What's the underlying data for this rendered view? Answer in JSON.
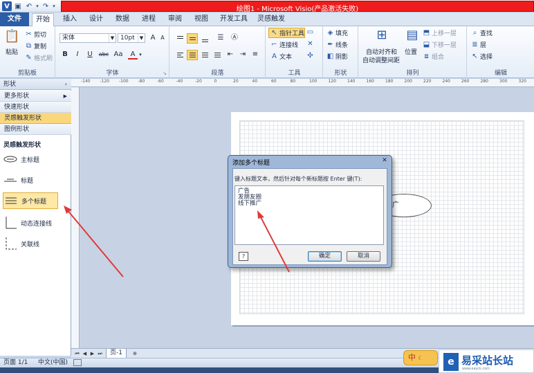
{
  "app": {
    "window_title": "绘图1 - Microsoft Visio(产品激活失败)"
  },
  "tabs": [
    "文件",
    "开始",
    "插入",
    "设计",
    "数据",
    "进程",
    "审阅",
    "视图",
    "开发工具",
    "灵感触发"
  ],
  "ribbon": {
    "clipboard": {
      "paste": "粘贴",
      "cut": "剪切",
      "copy": "复制",
      "format_painter": "格式刷",
      "label": "剪贴板"
    },
    "font": {
      "font_name": "宋体",
      "font_size": "10pt",
      "bold": "B",
      "italic": "I",
      "underline": "U",
      "strike": "abc",
      "case": "Aa",
      "color": "A",
      "label": "字体"
    },
    "paragraph": {
      "label": "段落"
    },
    "tools": {
      "pointer": "指针工具",
      "connector": "连接线",
      "text": "文本",
      "label": "工具"
    },
    "shape": {
      "fill": "填充",
      "line": "线条",
      "shadow": "阴影",
      "label": "形状"
    },
    "arrange": {
      "auto_align": "自动对齐和",
      "auto_space": "自动调整间距",
      "position": "位置",
      "bring_forward": "上移一层",
      "send_backward": "下移一层",
      "group": "组合",
      "label": "排列"
    },
    "editing": {
      "find": "查找",
      "layers": "层",
      "select": "选择",
      "label": "编辑"
    }
  },
  "shapes_panel": {
    "title": "形状",
    "rows": [
      "更多形状",
      "快速形状",
      "灵感触发形状",
      "图例形状"
    ],
    "stencil_title": "灵感触发形状",
    "stencil_items": [
      "主标题",
      "标题",
      "多个标题",
      "动态连接线",
      "关联线"
    ]
  },
  "ruler": {
    "h_ticks": [
      "-140",
      "-120",
      "-100",
      "-80",
      "-60",
      "-40",
      "-20",
      "0",
      "20",
      "40",
      "60",
      "80",
      "100",
      "120",
      "140",
      "160",
      "180",
      "200",
      "220",
      "240",
      "260",
      "280",
      "300",
      "320"
    ]
  },
  "canvas": {
    "shape_text": "广"
  },
  "dialog": {
    "title": "添加多个标题",
    "prompt": "键入标题文本，然后针对每个新标题按 Enter 键(T):",
    "lines": [
      "广告",
      "发朋友圈",
      "线下推广"
    ],
    "help": "?",
    "ok": "确定",
    "cancel": "取消"
  },
  "sheet": {
    "page_tab": "页-1"
  },
  "status": {
    "page": "页面 1/1",
    "language": "中文(中国)"
  },
  "overlays": {
    "ime": "中",
    "watermark_text": "易采站长站",
    "watermark_sub": "www.easck.com"
  },
  "colors": {
    "accent": "#2c5da6",
    "selected": "#fbd77b",
    "alert_bar": "#ee1c1c",
    "arrow": "#e03a3a"
  }
}
